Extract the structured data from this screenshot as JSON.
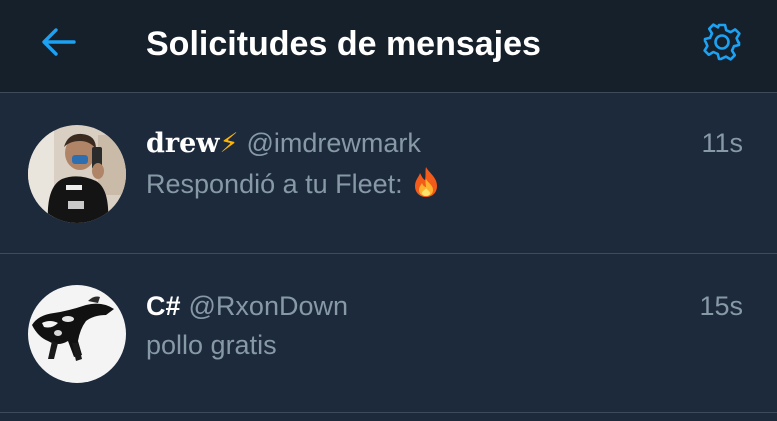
{
  "header": {
    "title": "Solicitudes de mensajes",
    "back_icon": "arrow-left-icon",
    "settings_icon": "gear-icon"
  },
  "colors": {
    "background": "#1c2a3c",
    "header_background": "#15202b",
    "accent": "#1da1f2",
    "secondary_text": "#8899a6",
    "divider": "#3d4b5a"
  },
  "requests": [
    {
      "name": "drew",
      "name_emoji": "⚡",
      "handle": "@imdrewmark",
      "time": "11s",
      "message": "Respondió a tu Fleet:",
      "message_emoji": "fire-emoji"
    },
    {
      "name": "C#",
      "handle": "@RxonDown",
      "time": "15s",
      "message": "pollo gratis"
    }
  ]
}
